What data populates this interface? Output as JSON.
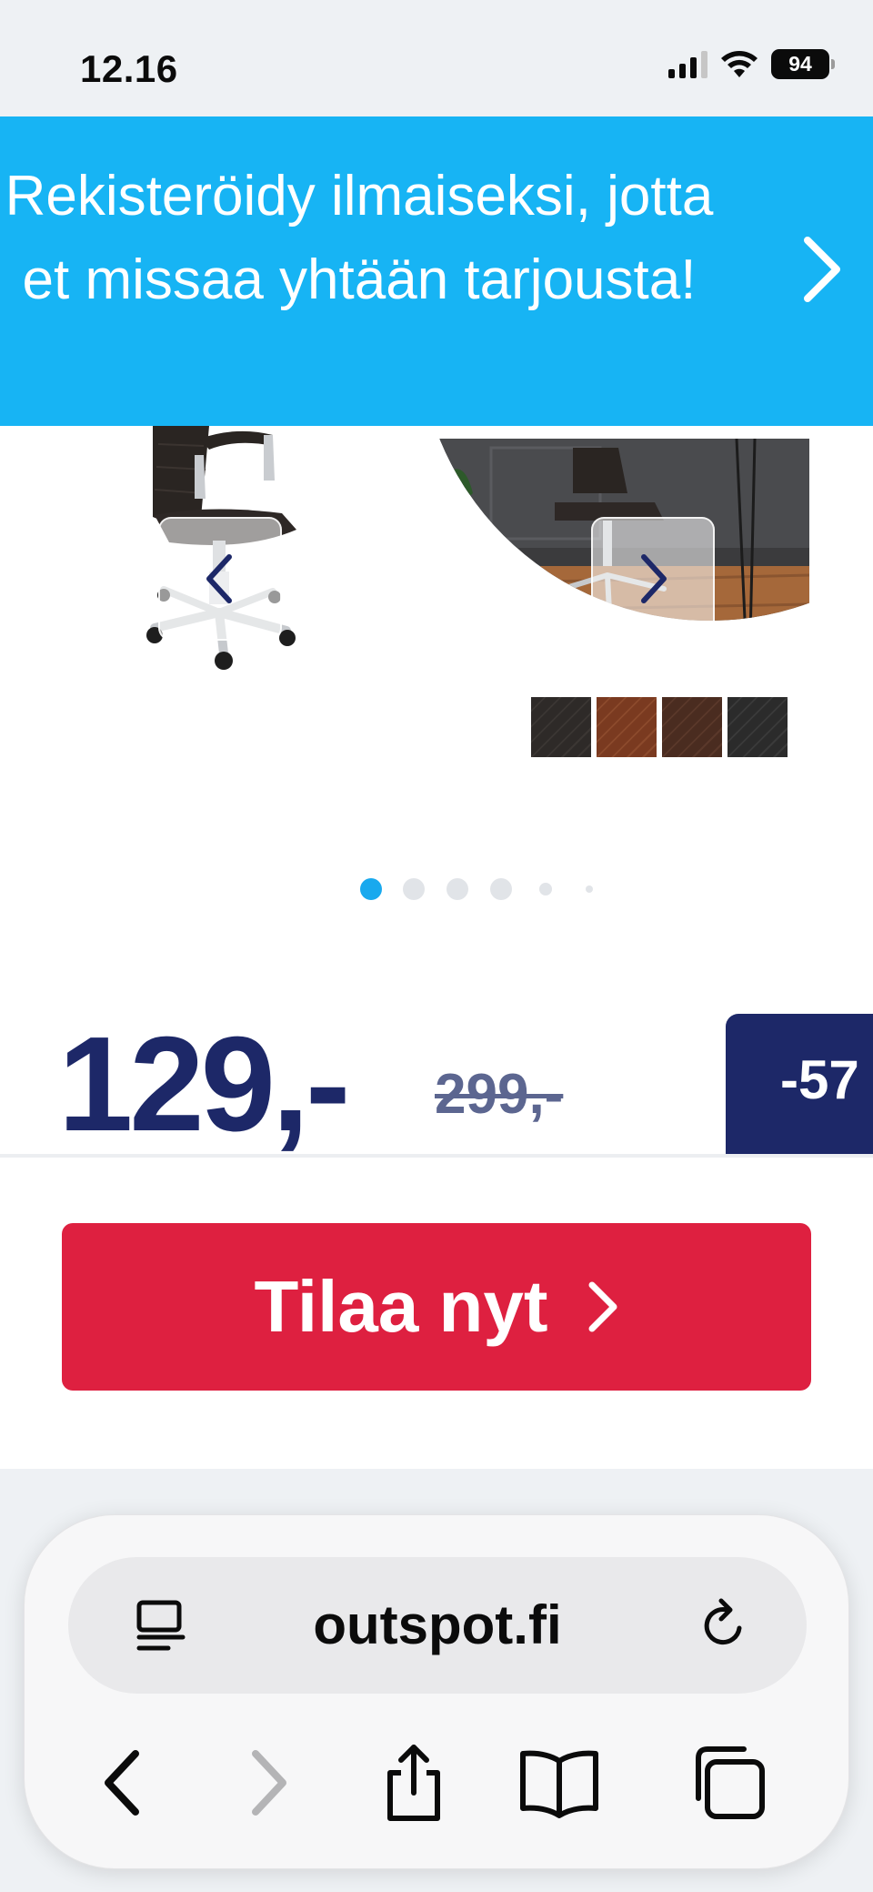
{
  "status_bar": {
    "time": "12.16",
    "battery": "94"
  },
  "promo_banner": {
    "text": "Rekisteröidy ilmaiseksi, jotta et missaa yhtään tarjousta!",
    "arrow_icon": "chevron-right-icon"
  },
  "carousel": {
    "prev_icon": "chevron-left-icon",
    "next_icon": "chevron-right-icon",
    "swatch_colors": [
      "#2e2a28",
      "#7a3a20",
      "#4a2c20",
      "#2b2b2b"
    ],
    "dot_count": 6,
    "active_index": 0,
    "active_color": "#19a9ee"
  },
  "price": {
    "current": "129,-",
    "original": "299,-",
    "discount": "-57"
  },
  "cta": {
    "label": "Tilaa nyt",
    "color": "#de2040"
  },
  "browser": {
    "url": "outspot.fi",
    "icons": [
      "reader-icon",
      "reload-icon",
      "back-icon",
      "forward-icon",
      "share-icon",
      "bookmarks-icon",
      "tabs-icon"
    ]
  },
  "colors": {
    "banner": "#17b4f4",
    "navy": "#1d2868"
  }
}
